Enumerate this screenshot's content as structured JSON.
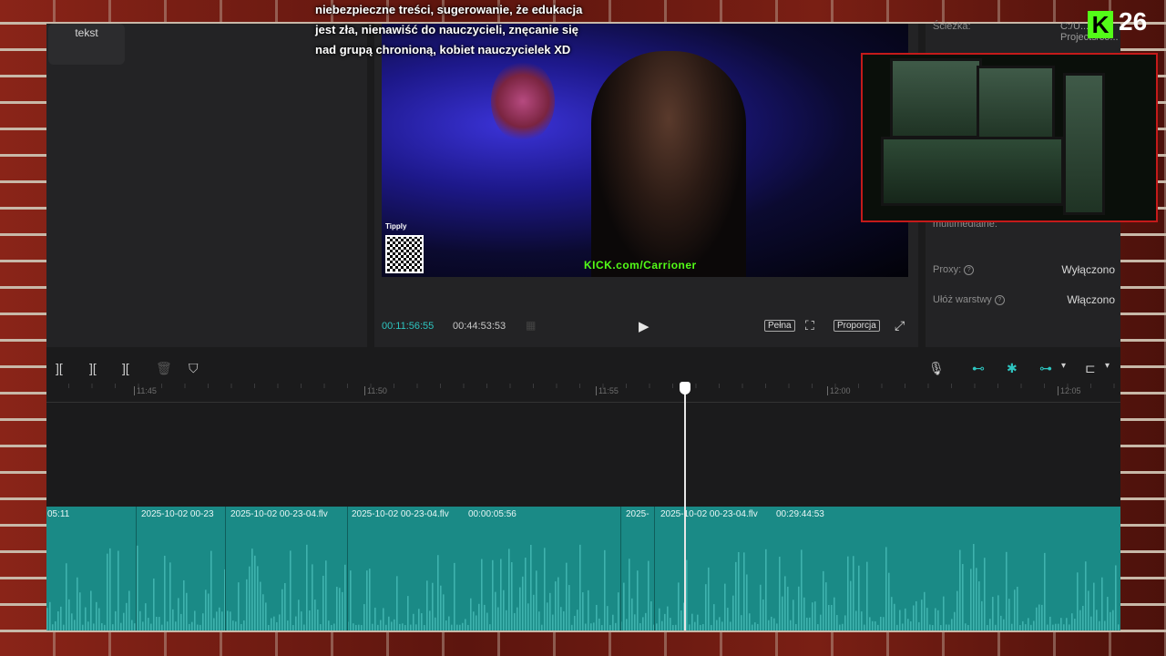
{
  "overlay": {
    "subtitle_lines": [
      "niebezpieczne treści, sugerowanie, że edukacja",
      "jest zła, nienawiść do nauczycieli, znęcanie się",
      "nad grupą chronioną, kobiet nauczycielek XD"
    ],
    "kick_logo": "K",
    "kick_count": "26"
  },
  "left_panel": {
    "tab_label": "tekst"
  },
  "player": {
    "tipply_label": "Tipply",
    "kick_url": "KICK.com/Carrioner",
    "current_time": "00:11:56:55",
    "total_time": "00:44:53:53",
    "btn_full": "Pełna",
    "btn_ratio": "Proporcja"
  },
  "properties": {
    "path_label": "Ścieżka:",
    "path_value": "C:/U... Projects/co...",
    "media_label": "multimedialne:",
    "proxy_label": "Proxy:",
    "proxy_value": "Wyłączono",
    "layers_label": "Ułóż warstwy",
    "layers_value": "Włączono"
  },
  "timeline": {
    "ticks": [
      "11:45",
      "11:50",
      "11:55",
      "12:00",
      "12:05"
    ],
    "clips": [
      "05:11",
      "2025-10-02 00-23",
      "2025-10-02 00-23-04.flv",
      "2025-10-02 00-23-04.flv",
      "00:00:05:56",
      "2025-",
      "2025-10-02 00-23-04.flv",
      "00:29:44:53"
    ]
  },
  "colors": {
    "accent": "#2ec5c0",
    "audio_track": "#1a8a86",
    "kick_green": "#53fc18",
    "webcam_border": "#c41a1a"
  }
}
